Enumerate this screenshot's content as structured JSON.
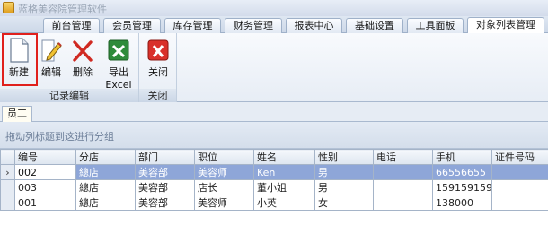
{
  "window": {
    "title": "蓝格美容院管理软件"
  },
  "tabs": [
    {
      "label": "前台管理",
      "active": false
    },
    {
      "label": "会员管理",
      "active": false
    },
    {
      "label": "库存管理",
      "active": false
    },
    {
      "label": "财务管理",
      "active": false
    },
    {
      "label": "报表中心",
      "active": false
    },
    {
      "label": "基础设置",
      "active": false
    },
    {
      "label": "工具面板",
      "active": false
    },
    {
      "label": "对象列表管理",
      "active": true
    }
  ],
  "ribbon": {
    "groups": [
      {
        "label": "记录编辑",
        "buttons": [
          {
            "label": "新建",
            "icon": "new-document-icon",
            "highlighted": true
          },
          {
            "label": "编辑",
            "icon": "pencil-edit-icon"
          },
          {
            "label": "删除",
            "icon": "red-x-delete-icon"
          },
          {
            "label": "导出Excel",
            "icon": "excel-export-icon"
          }
        ]
      },
      {
        "label": "关闭",
        "buttons": [
          {
            "label": "关闭",
            "icon": "close-icon"
          }
        ]
      }
    ]
  },
  "subtab": {
    "label": "员工"
  },
  "group_panel": {
    "hint": "拖动列标题到这进行分组"
  },
  "grid": {
    "columns": [
      "编号",
      "分店",
      "部门",
      "职位",
      "姓名",
      "性别",
      "电话",
      "手机",
      "证件号码"
    ],
    "rows": [
      {
        "indicator": "›",
        "selected": true,
        "cells": [
          "002",
          "總店",
          "美容部",
          "美容师",
          "Ken",
          "男",
          "",
          "66556655",
          ""
        ]
      },
      {
        "indicator": "",
        "selected": false,
        "cells": [
          "003",
          "總店",
          "美容部",
          "店长",
          "董小姐",
          "男",
          "",
          "159159159",
          ""
        ]
      },
      {
        "indicator": "",
        "selected": false,
        "cells": [
          "001",
          "總店",
          "美容部",
          "美容师",
          "小英",
          "女",
          "",
          "138000",
          ""
        ]
      }
    ]
  },
  "colors": {
    "selection": "#8ea6d8",
    "highlight_border": "#e0201c"
  }
}
